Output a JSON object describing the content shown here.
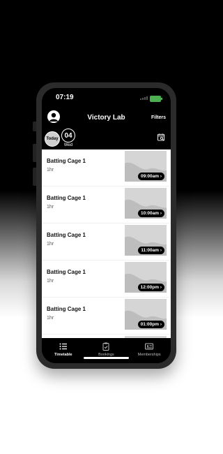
{
  "status_bar": {
    "time": "07:19"
  },
  "header": {
    "title": "Victory Lab",
    "filters_label": "Filters"
  },
  "date_bar": {
    "today_label": "Today",
    "day_number": "04",
    "day_name": "Wed"
  },
  "bookings": [
    {
      "name": "Batting Cage 1",
      "duration": "1hr",
      "time": "09:00am"
    },
    {
      "name": "Batting Cage 1",
      "duration": "1hr",
      "time": "10:00am"
    },
    {
      "name": "Batting Cage 1",
      "duration": "1hr",
      "time": "11:00am"
    },
    {
      "name": "Batting Cage 1",
      "duration": "1hr",
      "time": "12:00pm"
    },
    {
      "name": "Batting Cage 1",
      "duration": "1hr",
      "time": "01:00pm"
    }
  ],
  "tabs": [
    {
      "label": "Timetable",
      "icon": "list-icon",
      "active": true
    },
    {
      "label": "Bookings",
      "icon": "clipboard-icon",
      "active": false
    },
    {
      "label": "Memberships",
      "icon": "card-icon",
      "active": false
    }
  ],
  "colors": {
    "battery": "#4caf50",
    "screen_bg": "#000000",
    "list_bg": "#ffffff",
    "frame": "#2b2b2b"
  }
}
